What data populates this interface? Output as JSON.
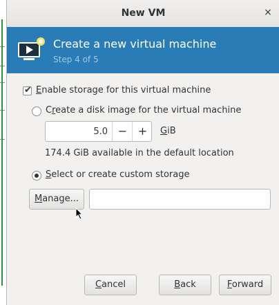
{
  "window": {
    "title": "New VM",
    "close_glyph": "×"
  },
  "header": {
    "title": "Create a new virtual machine",
    "step": "Step 4 of 5",
    "icon": "monitor-play-icon",
    "accent_color": "#2a7cb6"
  },
  "storage": {
    "enable_checkbox": {
      "mnemonic": "E",
      "rest": "nable storage for this virtual machine",
      "checked": true
    },
    "create_disk_radio": {
      "pre": "C",
      "mnemonic": "r",
      "rest": "eate a disk image for the virtual machine",
      "selected": false
    },
    "disk_size": {
      "value": "5.0",
      "minus": "−",
      "plus": "+",
      "unit_mnemonic": "G",
      "unit_rest": "iB"
    },
    "available_text": "174.4 GiB available in the default location",
    "custom_storage_radio": {
      "mnemonic": "S",
      "rest": "elect or create custom storage",
      "selected": true
    },
    "manage_button": {
      "mnemonic": "M",
      "rest": "anage..."
    },
    "path_entry": {
      "value": ""
    }
  },
  "footer": {
    "cancel": {
      "mnemonic": "C",
      "rest": "ancel"
    },
    "back": {
      "mnemonic": "B",
      "rest": "ack"
    },
    "forward": {
      "mnemonic": "F",
      "rest": "orward"
    }
  }
}
